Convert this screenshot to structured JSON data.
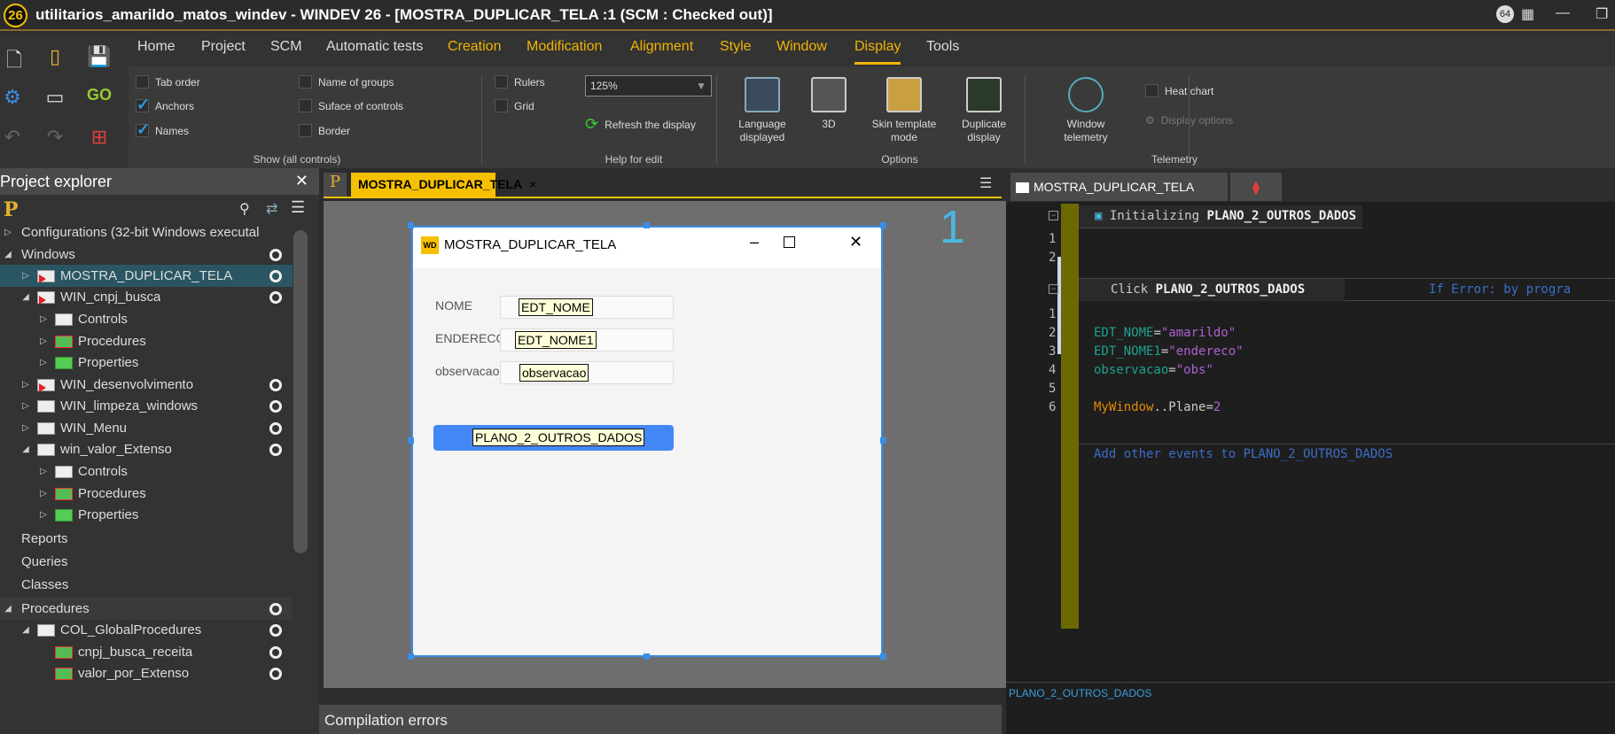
{
  "titlebar": {
    "logo": "26",
    "title": "utilitarios_amarildo_matos_windev - WINDEV 26 - [MOSTRA_DUPLICAR_TELA :1 (SCM : Checked out)]",
    "badge": "64"
  },
  "ribbon": {
    "tabs": [
      "Home",
      "Project",
      "SCM",
      "Automatic tests",
      "Creation",
      "Modification",
      "Alignment",
      "Style",
      "Window",
      "Display",
      "Tools"
    ],
    "show": {
      "tab_order": "Tab order",
      "anchors": "Anchors",
      "names": "Names",
      "name_of_groups": "Name of groups",
      "surface": "Suface of controls",
      "border": "Border",
      "group": "Show (all controls)"
    },
    "help": {
      "rulers": "Rulers",
      "grid": "Grid",
      "zoom": "125%",
      "refresh": "Refresh the display",
      "group": "Help for edit"
    },
    "options": {
      "language": "Language displayed",
      "threed": "3D",
      "skin": "Skin template mode",
      "duplicate": "Duplicate display",
      "group": "Options"
    },
    "telemetry": {
      "window": "Window telemetry",
      "heat": "Heat chart",
      "display_options": "Display options",
      "group": "Telemetry"
    }
  },
  "explorer": {
    "title": "Project explorer",
    "items": [
      "Configurations (32-bit Windows executal",
      "Windows",
      "MOSTRA_DUPLICAR_TELA",
      "WIN_cnpj_busca",
      "Controls",
      "Procedures",
      "Properties",
      "WIN_desenvolvimento",
      "WIN_limpeza_windows",
      "WIN_Menu",
      "win_valor_Extenso",
      "Controls",
      "Procedures",
      "Properties",
      "Reports",
      "Queries",
      "Classes",
      "Procedures",
      "COL_GlobalProcedures",
      "cnpj_busca_receita",
      "valor_por_Extenso"
    ]
  },
  "editor": {
    "tab": "MOSTRA_DUPLICAR_TELA",
    "plane": "1",
    "window_title": "MOSTRA_DUPLICAR_TELA",
    "labels": [
      "NOME",
      "ENDERECO",
      "observacao"
    ],
    "fields": [
      "EDT_NOME",
      "EDT_NOME1",
      "observacao"
    ],
    "button": "PLANO_2_OUTROS_DADOS",
    "compilation": "Compilation errors"
  },
  "code": {
    "tab": "MOSTRA_DUPLICAR_TELA",
    "init_kw": "Initializing",
    "init_name": "PLANO_2_OUTROS_DADOS",
    "init_lines": [
      "1",
      "2"
    ],
    "click_kw": "Click",
    "click_name": "PLANO_2_OUTROS_DADOS",
    "if_error": "If Error: by progra",
    "line_numbers": [
      "1",
      "2",
      "3",
      "4",
      "5",
      "6"
    ],
    "l2a": "EDT_NOME",
    "l2b": "=",
    "l2c": "\"amarildo\"",
    "l3a": "EDT_NOME1",
    "l3b": "=",
    "l3c": "\"endereco\"",
    "l4a": "observacao",
    "l4b": "=",
    "l4c": "\"obs\"",
    "l6a": "MyWindow",
    "l6b": "..Plane=",
    "l6c": "2",
    "add_events": "Add other events to PLANO_2_OUTROS_DADOS",
    "status": "PLANO_2_OUTROS_DADOS"
  }
}
